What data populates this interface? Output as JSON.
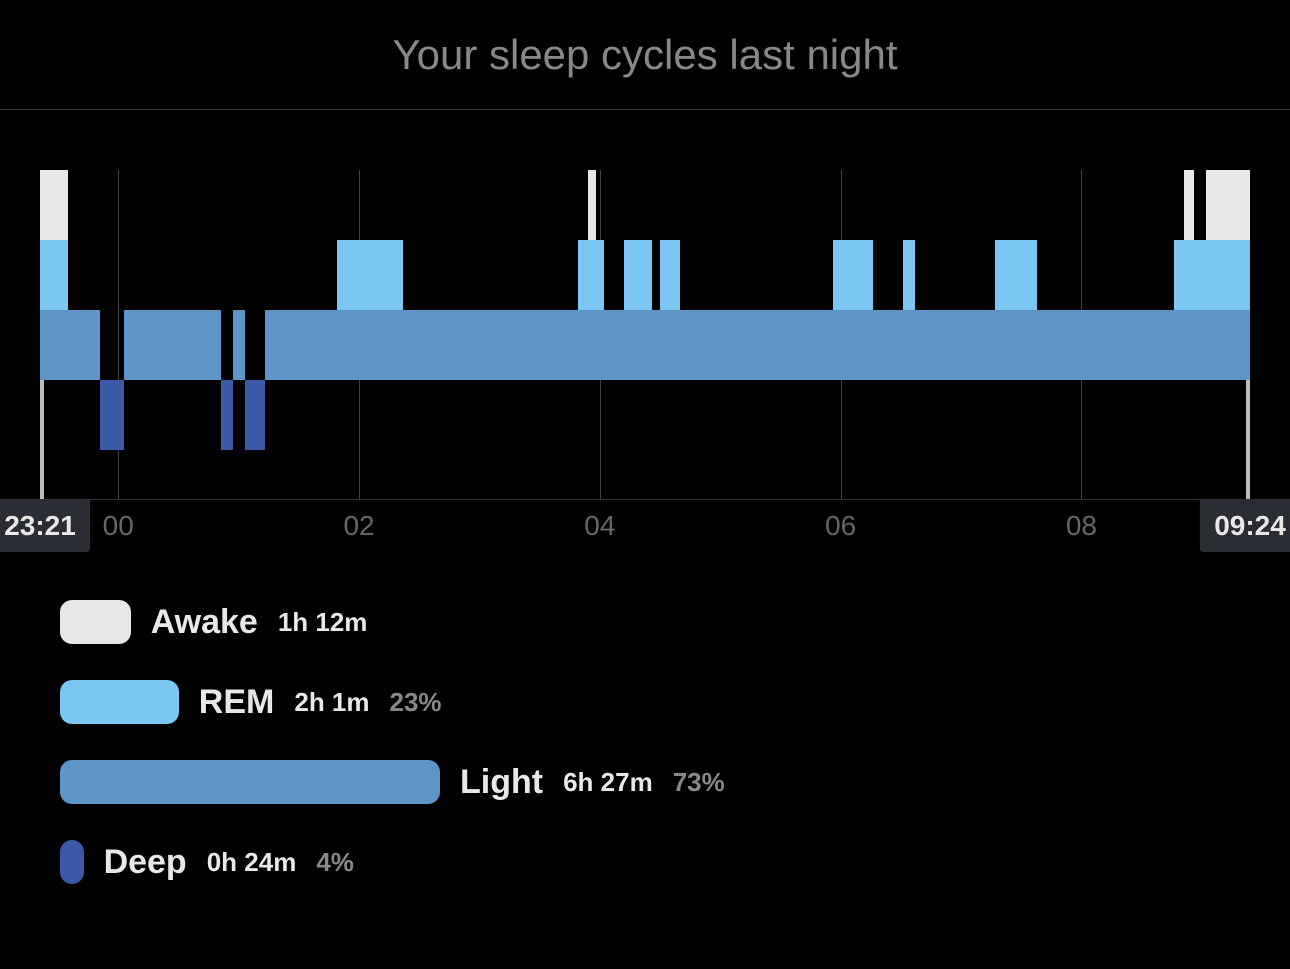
{
  "title": "Your sleep cycles last night",
  "start_marker": "23:21",
  "end_marker": "09:24",
  "colors": {
    "awake": "#e8e8ea",
    "rem": "#7cc7f2",
    "light": "#5d95c9",
    "deep": "#3a5aa8"
  },
  "legend": {
    "awake": {
      "name": "Awake",
      "duration": "1h 12m"
    },
    "rem": {
      "name": "REM",
      "duration": "2h 1m",
      "percent": "23%"
    },
    "light": {
      "name": "Light",
      "duration": "6h 27m",
      "percent": "73%"
    },
    "deep": {
      "name": "Deep",
      "duration": "0h 24m",
      "percent": "4%"
    }
  },
  "chart_data": {
    "type": "area",
    "title": "Your sleep cycles last night",
    "xlabel": "",
    "ylabel": "",
    "x_range_minutes": [
      0,
      603
    ],
    "x_ticks": [
      {
        "label": "00",
        "minute": 39
      },
      {
        "label": "02",
        "minute": 159
      },
      {
        "label": "04",
        "minute": 279
      },
      {
        "label": "06",
        "minute": 399
      },
      {
        "label": "08",
        "minute": 519
      }
    ],
    "stages": [
      "awake",
      "rem",
      "light",
      "deep"
    ],
    "segments": [
      {
        "stage": "awake",
        "start": 0,
        "end": 14
      },
      {
        "stage": "light",
        "start": 14,
        "end": 30
      },
      {
        "stage": "deep",
        "start": 30,
        "end": 42
      },
      {
        "stage": "light",
        "start": 42,
        "end": 90
      },
      {
        "stage": "deep",
        "start": 90,
        "end": 96
      },
      {
        "stage": "light",
        "start": 96,
        "end": 102
      },
      {
        "stage": "deep",
        "start": 102,
        "end": 112
      },
      {
        "stage": "light",
        "start": 112,
        "end": 148
      },
      {
        "stage": "rem",
        "start": 148,
        "end": 181
      },
      {
        "stage": "light",
        "start": 181,
        "end": 268
      },
      {
        "stage": "rem",
        "start": 268,
        "end": 273
      },
      {
        "stage": "awake",
        "start": 273,
        "end": 277
      },
      {
        "stage": "rem",
        "start": 277,
        "end": 281
      },
      {
        "stage": "light",
        "start": 281,
        "end": 291
      },
      {
        "stage": "rem",
        "start": 291,
        "end": 305
      },
      {
        "stage": "light",
        "start": 305,
        "end": 309
      },
      {
        "stage": "rem",
        "start": 309,
        "end": 319
      },
      {
        "stage": "light",
        "start": 319,
        "end": 395
      },
      {
        "stage": "rem",
        "start": 395,
        "end": 415
      },
      {
        "stage": "light",
        "start": 415,
        "end": 430
      },
      {
        "stage": "rem",
        "start": 430,
        "end": 436
      },
      {
        "stage": "light",
        "start": 436,
        "end": 476
      },
      {
        "stage": "rem",
        "start": 476,
        "end": 497
      },
      {
        "stage": "light",
        "start": 497,
        "end": 565
      },
      {
        "stage": "rem",
        "start": 565,
        "end": 570
      },
      {
        "stage": "awake",
        "start": 570,
        "end": 575
      },
      {
        "stage": "rem",
        "start": 575,
        "end": 581
      },
      {
        "stage": "awake",
        "start": 581,
        "end": 603
      }
    ],
    "stage_summary": {
      "awake": {
        "minutes": 72,
        "percent_of_sleep": null
      },
      "rem": {
        "minutes": 121,
        "percent_of_sleep": 23
      },
      "light": {
        "minutes": 387,
        "percent_of_sleep": 73
      },
      "deep": {
        "minutes": 24,
        "percent_of_sleep": 4
      }
    },
    "start_time": "23:21",
    "end_time": "09:24"
  }
}
